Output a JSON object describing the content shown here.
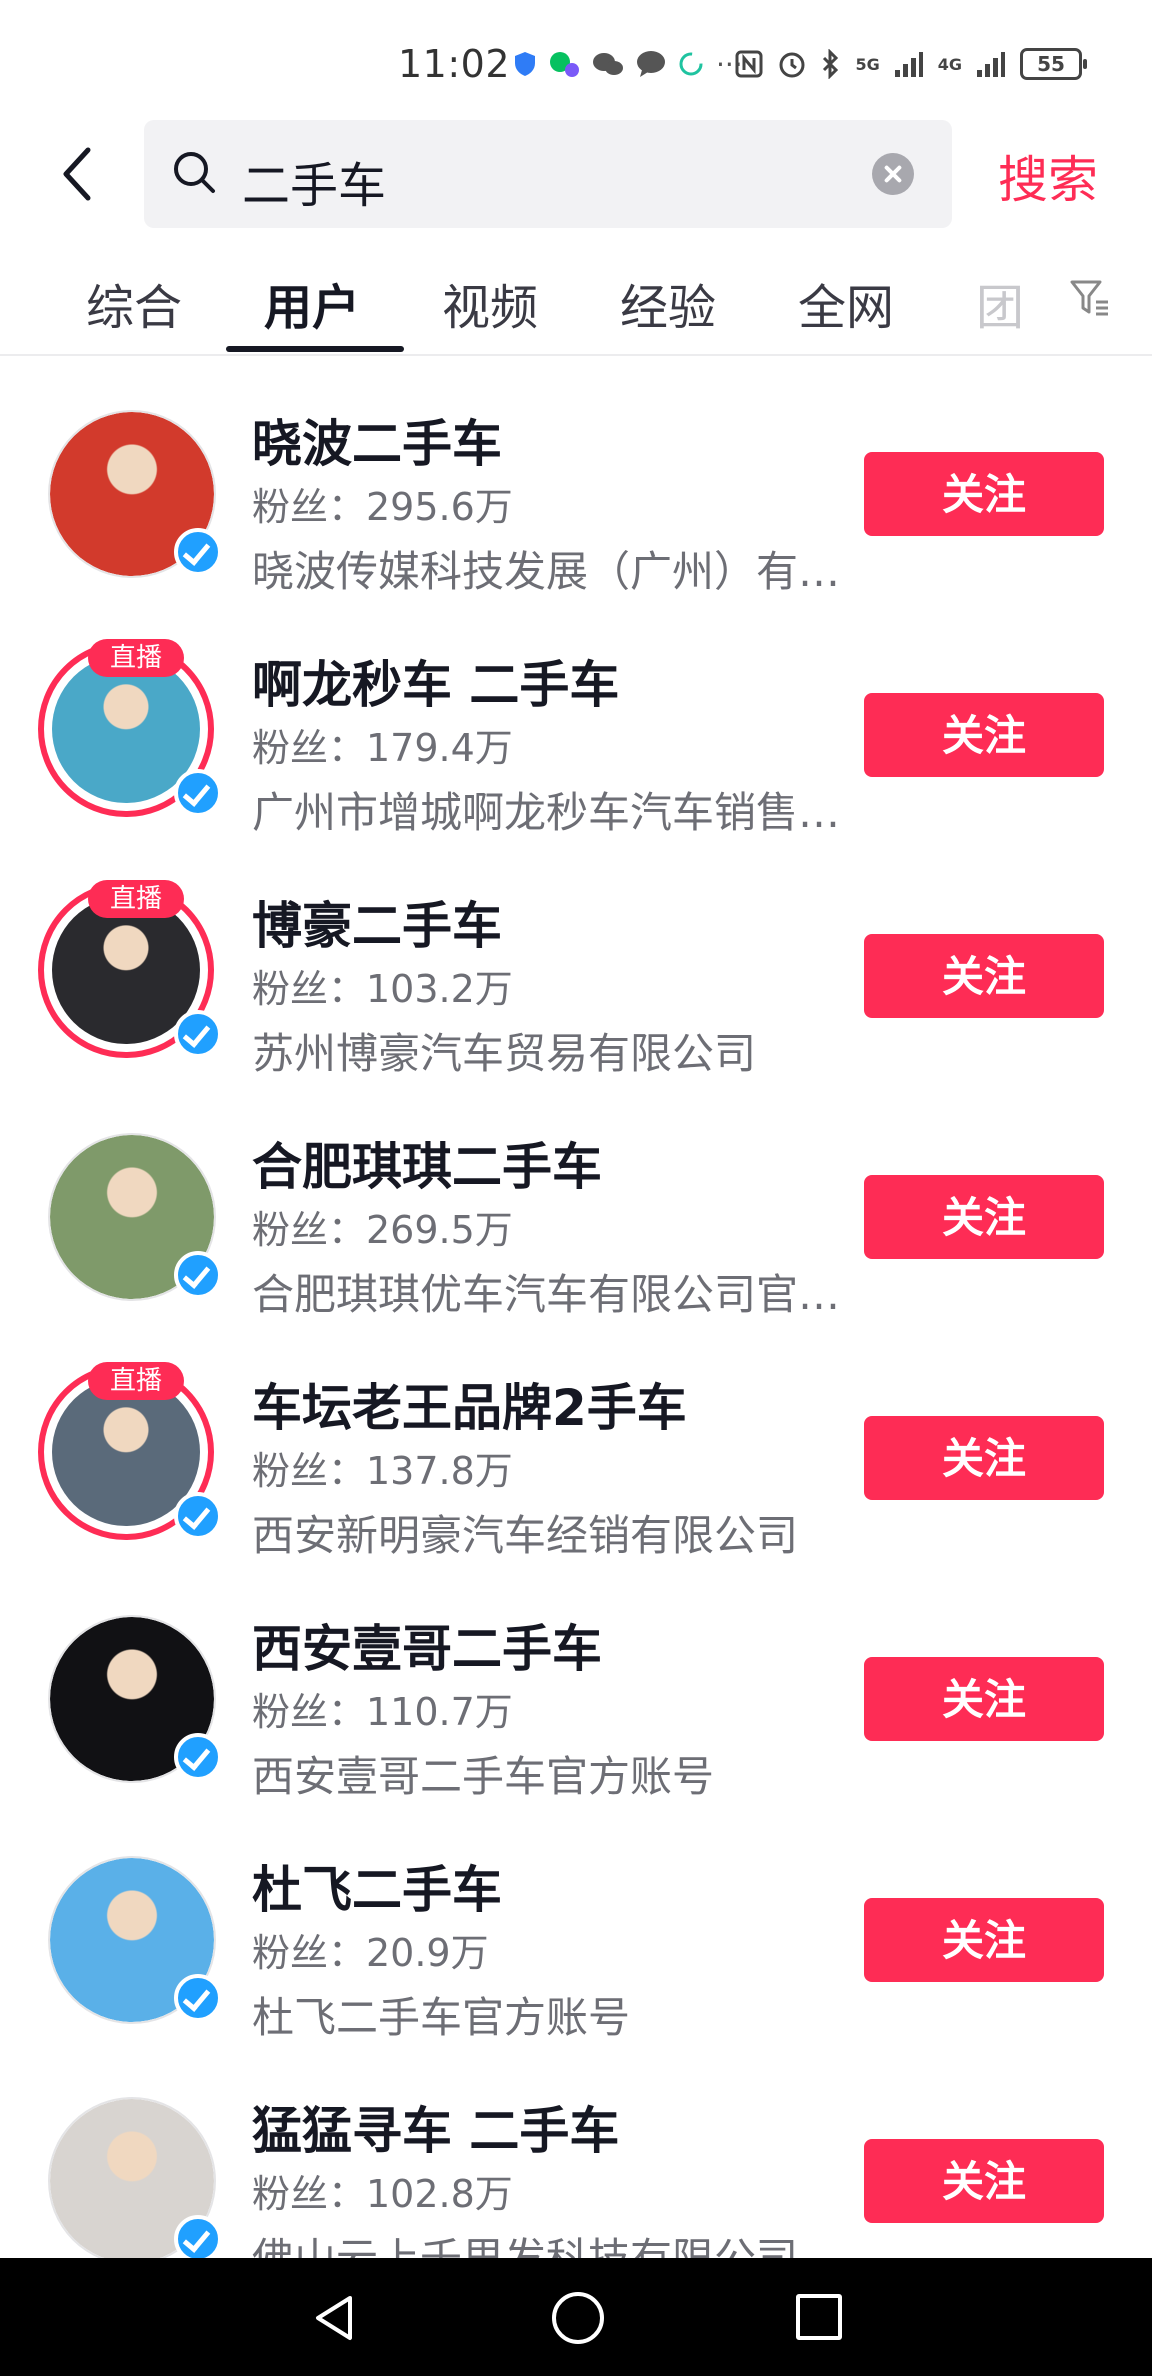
{
  "status_bar": {
    "time": "11:02",
    "battery": "55",
    "network_5g": "5G",
    "network_4g": "4G"
  },
  "search": {
    "query": "二手车",
    "search_label": "搜索"
  },
  "tabs": [
    {
      "label": "综合"
    },
    {
      "label": "用户"
    },
    {
      "label": "视频"
    },
    {
      "label": "经验"
    },
    {
      "label": "全网"
    },
    {
      "label": "团"
    }
  ],
  "live_label": "直播",
  "users": [
    {
      "name": "晓波二手车",
      "fans": "粉丝：295.6万",
      "desc": "晓波传媒科技发展（广州）有限公司",
      "live": false,
      "avatar_color": "#d23a2c",
      "follow": "关注"
    },
    {
      "name": "啊龙秒车  二手车",
      "fans": "粉丝：179.4万",
      "desc": "广州市增城啊龙秒车汽车销售有限公司",
      "live": true,
      "avatar_color": "#4aa8c8",
      "follow": "关注"
    },
    {
      "name": "博豪二手车",
      "fans": "粉丝：103.2万",
      "desc": "苏州博豪汽车贸易有限公司",
      "live": true,
      "avatar_color": "#2a2a2e",
      "follow": "关注"
    },
    {
      "name": "合肥琪琪二手车",
      "fans": "粉丝：269.5万",
      "desc": "合肥琪琪优车汽车有限公司官方账号",
      "live": false,
      "avatar_color": "#7f9a6a",
      "follow": "关注"
    },
    {
      "name": "车坛老王品牌2手车",
      "fans": "粉丝：137.8万",
      "desc": "西安新明豪汽车经销有限公司",
      "live": true,
      "avatar_color": "#5a6a7a",
      "follow": "关注"
    },
    {
      "name": "西安壹哥二手车",
      "fans": "粉丝：110.7万",
      "desc": "西安壹哥二手车官方账号",
      "live": false,
      "avatar_color": "#111114",
      "follow": "关注"
    },
    {
      "name": "杜飞二手车",
      "fans": "粉丝：20.9万",
      "desc": "杜飞二手车官方账号",
      "live": false,
      "avatar_color": "#5ab0e8",
      "follow": "关注"
    },
    {
      "name": "猛猛寻车 二手车",
      "fans": "粉丝：102.8万",
      "desc": "佛山云上千里发科技有限公司",
      "live": false,
      "avatar_color": "#d8d4d0",
      "follow": "关注"
    }
  ],
  "colors": {
    "accent": "#fe2c55",
    "verified": "#20a0ff"
  }
}
